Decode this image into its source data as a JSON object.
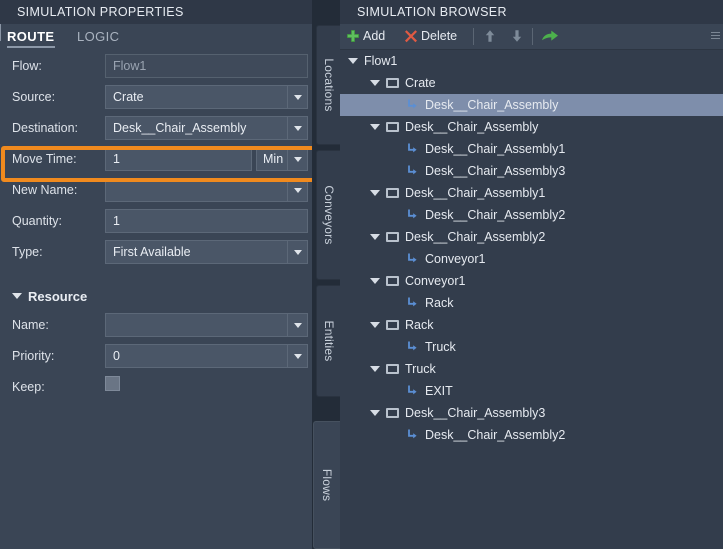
{
  "properties_panel": {
    "title": "SIMULATION PROPERTIES",
    "tabs": [
      {
        "label": "ROUTE",
        "active": true
      },
      {
        "label": "LOGIC",
        "active": false
      }
    ],
    "fields": [
      {
        "label": "Flow:",
        "value": "Flow1",
        "control": "readonly-text"
      },
      {
        "label": "Source:",
        "value": "Crate",
        "control": "dropdown"
      },
      {
        "label": "Destination:",
        "value": "Desk__Chair_Assembly",
        "control": "dropdown"
      },
      {
        "label": "Move Time:",
        "value": "1",
        "unit": "Min",
        "control": "text-with-unit-dropdown",
        "highlighted": true
      },
      {
        "label": "New Name:",
        "value": "",
        "control": "dropdown"
      },
      {
        "label": "Quantity:",
        "value": "1",
        "control": "text"
      },
      {
        "label": "Type:",
        "value": "First Available",
        "control": "dropdown"
      }
    ],
    "resource_group": {
      "label": "Resource",
      "expanded": true,
      "fields": [
        {
          "label": "Name:",
          "value": "",
          "control": "dropdown"
        },
        {
          "label": "Priority:",
          "value": "0",
          "control": "dropdown"
        },
        {
          "label": "Keep:",
          "value": "",
          "control": "checkbox",
          "checked": false
        }
      ]
    },
    "highlight_color": "#f08a1e"
  },
  "vertical_tabs": [
    {
      "label": "Locations",
      "active": false
    },
    {
      "label": "Conveyors",
      "active": false
    },
    {
      "label": "Entities",
      "active": false
    },
    {
      "label": "Flows",
      "active": true
    }
  ],
  "browser_panel": {
    "title": "SIMULATION BROWSER",
    "toolbar": {
      "add_label": "Add",
      "delete_label": "Delete",
      "add_icon": "plus-icon",
      "delete_icon": "cross-icon",
      "move_up_icon": "arrow-up-icon",
      "move_down_icon": "arrow-down-icon",
      "goto_icon": "arrow-forward-icon",
      "overflow_icon": "overflow-icon"
    },
    "tree": [
      {
        "depth": 0,
        "icon": "expander",
        "label": "Flow1",
        "selected": false
      },
      {
        "depth": 1,
        "icon": "node",
        "label": "Crate",
        "selected": false
      },
      {
        "depth": 2,
        "icon": "link",
        "label": "Desk__Chair_Assembly",
        "selected": true
      },
      {
        "depth": 1,
        "icon": "node",
        "label": "Desk__Chair_Assembly",
        "selected": false
      },
      {
        "depth": 2,
        "icon": "link",
        "label": "Desk__Chair_Assembly1",
        "selected": false
      },
      {
        "depth": 2,
        "icon": "link",
        "label": "Desk__Chair_Assembly3",
        "selected": false
      },
      {
        "depth": 1,
        "icon": "node",
        "label": "Desk__Chair_Assembly1",
        "selected": false
      },
      {
        "depth": 2,
        "icon": "link",
        "label": "Desk__Chair_Assembly2",
        "selected": false
      },
      {
        "depth": 1,
        "icon": "node",
        "label": "Desk__Chair_Assembly2",
        "selected": false
      },
      {
        "depth": 2,
        "icon": "link",
        "label": "Conveyor1",
        "selected": false
      },
      {
        "depth": 1,
        "icon": "node",
        "label": "Conveyor1",
        "selected": false
      },
      {
        "depth": 2,
        "icon": "link",
        "label": "Rack",
        "selected": false
      },
      {
        "depth": 1,
        "icon": "node",
        "label": "Rack",
        "selected": false
      },
      {
        "depth": 2,
        "icon": "link",
        "label": "Truck",
        "selected": false
      },
      {
        "depth": 1,
        "icon": "node",
        "label": "Truck",
        "selected": false
      },
      {
        "depth": 2,
        "icon": "link",
        "label": "EXIT",
        "selected": false
      },
      {
        "depth": 1,
        "icon": "node",
        "label": "Desk__Chair_Assembly3",
        "selected": false
      },
      {
        "depth": 2,
        "icon": "link",
        "label": "Desk__Chair_Assembly2",
        "selected": false
      }
    ]
  },
  "colors": {
    "panel_bg": "#3a4555",
    "browser_bg": "#333d4c",
    "titlebar_bg": "#2f3847",
    "field_bg": "#4a5667",
    "selection": "#7e8eab",
    "accent_orange": "#f08a1e",
    "link_icon": "#5b8fd4",
    "add_green": "#5fbf5f",
    "delete_red": "#e05a43"
  }
}
